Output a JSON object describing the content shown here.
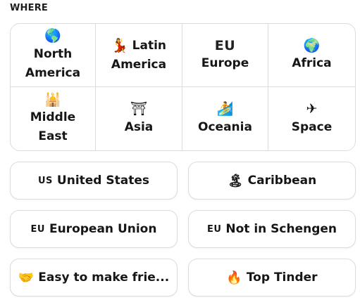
{
  "section": {
    "label": "WHERE"
  },
  "regions": [
    {
      "icon": "globe-americas",
      "glyph": "🌎",
      "line1": "North",
      "line2": "America"
    },
    {
      "icon": "dancer",
      "glyph": "💃",
      "line1": "Latin",
      "line2": "America"
    },
    {
      "icon": "eu-code",
      "glyph": "EU",
      "line1": "Europe"
    },
    {
      "icon": "globe-africa",
      "glyph": "🌍",
      "line1": "Africa"
    },
    {
      "icon": "mosque",
      "glyph": "🕌",
      "line1": "Middle",
      "line2": "East"
    },
    {
      "icon": "torii-gate",
      "glyph": "⛩",
      "line1": "Asia"
    },
    {
      "icon": "surfer",
      "glyph": "🏄",
      "line1": "Oceania"
    },
    {
      "icon": "rocket",
      "glyph": "✈",
      "line1": "Space"
    }
  ],
  "filters": [
    {
      "code": "US",
      "label": "United States"
    },
    {
      "icon": "beach-island",
      "glyph": "🏝",
      "label": "Caribbean"
    },
    {
      "code": "EU",
      "label": "European Union"
    },
    {
      "code": "EU",
      "label": "Not in Schengen"
    },
    {
      "icon": "handshake",
      "glyph": "🤝",
      "label": "Easy to make frie..."
    },
    {
      "icon": "fire",
      "glyph": "🔥",
      "label": "Top Tinder"
    }
  ]
}
